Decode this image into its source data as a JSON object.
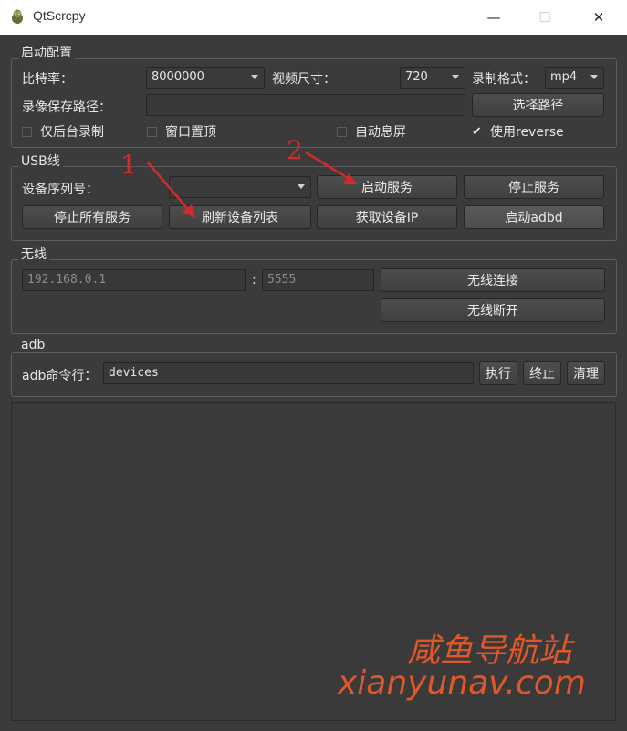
{
  "window": {
    "title": "QtScrcpy",
    "min_label": "—",
    "max_label": "☐",
    "close_label": "✕"
  },
  "config": {
    "group_title": "启动配置",
    "bitrate_label": "比特率：",
    "bitrate_value": "8000000",
    "size_label": "视频尺寸：",
    "size_value": "720",
    "format_label": "录制格式：",
    "format_value": "mp4",
    "record_path_label": "录像保存路径：",
    "record_path_value": "",
    "select_path_button": "选择路径",
    "background_record_label": "仅后台录制",
    "background_record_checked": false,
    "always_top_label": "窗口置顶",
    "always_top_checked": false,
    "close_screen_label": "自动息屏",
    "close_screen_checked": false,
    "use_reverse_label": "使用reverse",
    "use_reverse_checked": true
  },
  "usb": {
    "group_title": "USB线",
    "serial_label": "设备序列号：",
    "serial_value": "",
    "start_service_button": "启动服务",
    "stop_service_button": "停止服务",
    "stop_all_button": "停止所有服务",
    "refresh_devices_button": "刷新设备列表",
    "get_ip_button": "获取设备IP",
    "start_adbd_button": "启动adbd"
  },
  "wireless": {
    "group_title": "无线",
    "ip_placeholder": "192.168.0.1",
    "port_separator": ":",
    "port_placeholder": "5555",
    "connect_button": "无线连接",
    "disconnect_button": "无线断开"
  },
  "adb": {
    "group_title": "adb",
    "command_label": "adb命令行：",
    "command_value": "devices",
    "execute_button": "执行",
    "terminate_button": "终止",
    "clear_button": "清理"
  },
  "annotations": {
    "step1": "1",
    "step2": "2",
    "color": "#d42a2a"
  },
  "watermark": {
    "line1": "咸鱼导航站",
    "line2": "xianyunav.com",
    "color": "#e2572a"
  },
  "colors": {
    "background": "#3b3b3b",
    "titlebar": "#ffffff"
  }
}
